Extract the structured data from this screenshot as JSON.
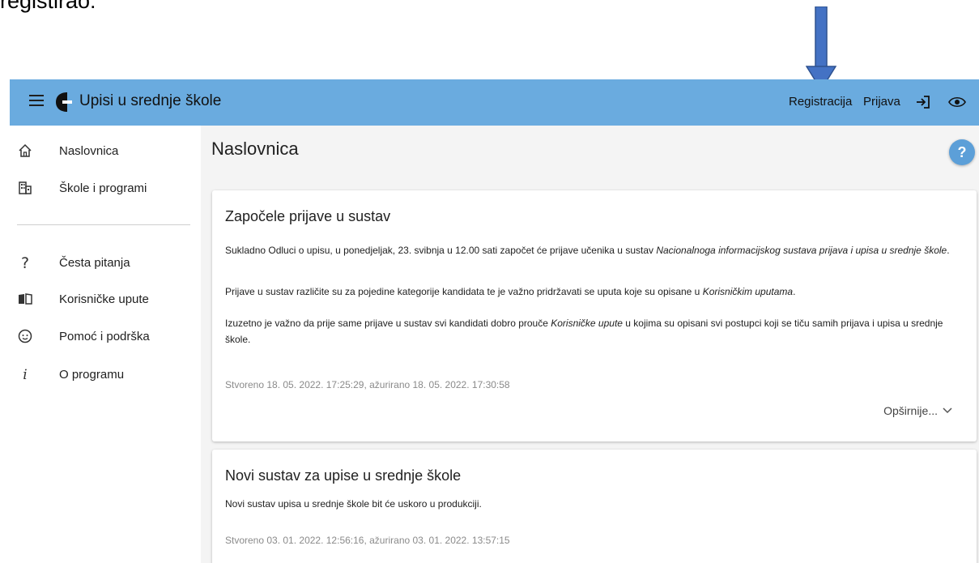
{
  "caption": "registirao:",
  "header": {
    "title": "Upisi u srednje škole",
    "register_label": "Registracija",
    "login_label": "Prijava"
  },
  "sidebar": {
    "items": [
      {
        "label": "Naslovnica",
        "icon": "home-icon"
      },
      {
        "label": "Škole i programi",
        "icon": "building-icon"
      },
      {
        "label": "Česta pitanja",
        "icon": "question-icon"
      },
      {
        "label": "Korisničke upute",
        "icon": "book-icon"
      },
      {
        "label": "Pomoć i podrška",
        "icon": "support-face-icon"
      },
      {
        "label": "O programu",
        "icon": "info-icon"
      }
    ]
  },
  "main": {
    "page_title": "Naslovnica",
    "help_label": "?",
    "posts": [
      {
        "title": "Započele prijave u sustav",
        "p1_a": "Sukladno Odluci o upisu, u ponedjeljak, 23. svibnja u 12.00 sati započet će prijave učenika u sustav ",
        "p1_em": "Nacionalnoga informacijskog sustava prijava i upisa u srednje škole",
        "p1_b": ".",
        "p2_a": "Prijave u sustav različite su za pojedine kategorije kandidata te je važno pridržavati se uputa koje su opisane u ",
        "p2_em": "Korisničkim uputama",
        "p2_b": ".",
        "p3_a": "Izuzetno je važno da prije same prijave u sustav svi kandidati dobro prouče ",
        "p3_em": "Korisničke upute",
        "p3_b": " u kojima su opisani svi postupci koji se tiču samih prijava i upisa u srednje škole.",
        "meta": "Stvoreno 18. 05. 2022. 17:25:29, ažurirano 18. 05. 2022. 17:30:58",
        "more_label": "Opširnije..."
      },
      {
        "title": "Novi sustav za upise u srednje škole",
        "p1": "Novi sustav upisa u srednje škole bit će uskoro u produkciji.",
        "meta": "Stvoreno 03. 01. 2022. 12:56:16, ažurirano 03. 01. 2022. 13:57:15"
      }
    ]
  },
  "colors": {
    "appbar": "#6aabdf",
    "arrow": "#4472c4",
    "help": "#5c9fd8"
  }
}
